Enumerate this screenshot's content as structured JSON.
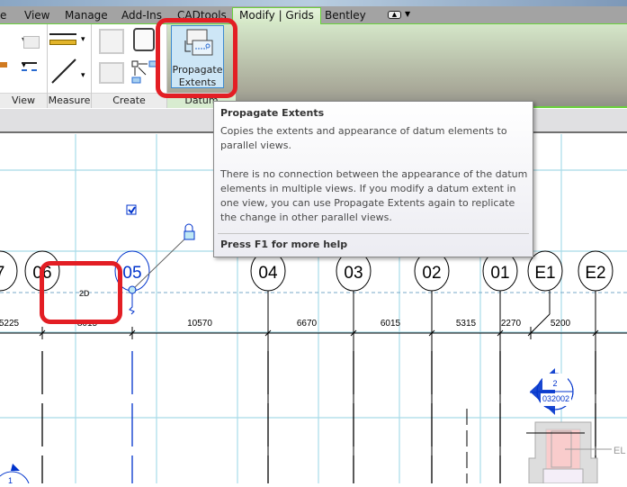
{
  "ribbon": {
    "tabs": [
      {
        "label": "e"
      },
      {
        "label": "View"
      },
      {
        "label": "Manage"
      },
      {
        "label": "Add-Ins"
      },
      {
        "label": "CADtools"
      },
      {
        "label": "Modify | Grids",
        "active": true
      },
      {
        "label": "Bentley"
      }
    ],
    "panels": [
      {
        "label": "View"
      },
      {
        "label": "Measure"
      },
      {
        "label": "Create"
      },
      {
        "label": "Datum"
      }
    ],
    "propagate_button": {
      "line1": "Propagate",
      "line2": "Extents"
    }
  },
  "tooltip": {
    "title": "Propagate Extents",
    "description": "Copies the extents and appearance of datum elements to parallel views.",
    "detail": "There is no connection between the appearance of the datum elements in multiple views. If you modify a datum extent in one view, you can use Propagate Extents again to replicate the change in other parallel views.",
    "help": "Press F1 for more help"
  },
  "canvas": {
    "grids": [
      "7",
      "06",
      "05",
      "04",
      "03",
      "02",
      "01",
      "E1",
      "E2"
    ],
    "selected_grid": "05",
    "grid_mode_label": "2D",
    "dimensions": [
      "5225",
      "8015",
      "10570",
      "6670",
      "6015",
      "5315",
      "2270",
      "5200"
    ],
    "section_tag": {
      "number": "2",
      "sheet": "032002"
    },
    "elevation_label": "EL",
    "corner_tag": "1"
  },
  "colors": {
    "highlight": "#e31e24",
    "selection": "#0033cc",
    "workplane": "#a8dbe8",
    "active_tab": "#6ad23c"
  }
}
